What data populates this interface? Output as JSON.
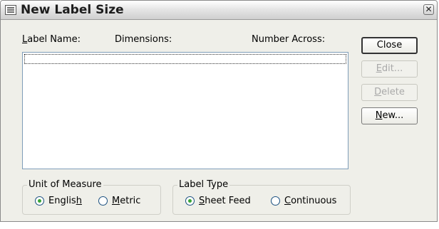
{
  "window": {
    "title": "New Label Size",
    "close_glyph": "✕"
  },
  "list": {
    "headers": {
      "label_name": "Label Name:",
      "dimensions": "Dimensions:",
      "number_across": "Number Across:"
    },
    "items": []
  },
  "buttons": {
    "close": {
      "label": "Close"
    },
    "edit": {
      "label": "Edit..."
    },
    "delete": {
      "label": "Delete"
    },
    "new": {
      "label": "New..."
    }
  },
  "unit_of_measure": {
    "title": "Unit of Measure",
    "options": [
      {
        "label": "English",
        "selected": true
      },
      {
        "label": "Metric",
        "selected": false
      }
    ]
  },
  "label_type": {
    "title": "Label Type",
    "options": [
      {
        "label": "Sheet Feed",
        "selected": true
      },
      {
        "label": "Continuous",
        "selected": false
      }
    ]
  }
}
